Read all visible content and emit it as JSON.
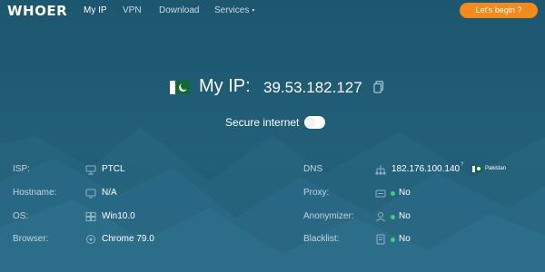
{
  "nav": {
    "logo": "WHOER",
    "items": [
      {
        "label": "My IP",
        "active": true
      },
      {
        "label": "VPN",
        "active": false
      },
      {
        "label": "Download",
        "active": false
      },
      {
        "label": "Services",
        "active": false
      }
    ],
    "services_caret": "▾",
    "cta_label": "Let's begin ?"
  },
  "hero": {
    "my_ip_label": "My IP:",
    "ip_address": "39.53.182.127",
    "flag_icon": "pakistan-flag-icon",
    "copy_icon": "copy-icon",
    "secure_label": "Secure internet",
    "secure_enabled": false
  },
  "left_rows": [
    {
      "label": "ISP:",
      "icon": "network-icon",
      "value": "PTCL"
    },
    {
      "label": "Hostname:",
      "icon": "monitor-icon",
      "value": "N/A"
    },
    {
      "label": "OS:",
      "icon": "windows-icon",
      "value": "Win10.0"
    },
    {
      "label": "Browser:",
      "icon": "browser-icon",
      "value": "Chrome 79.0"
    }
  ],
  "right_rows": [
    {
      "label": "DNS",
      "icon": "dns-icon",
      "value": "182.176.100.140",
      "sup": "?",
      "country": "Pakistan"
    },
    {
      "label": "Proxy:",
      "icon": "proxy-icon",
      "value": "No",
      "status": "green"
    },
    {
      "label": "Anonymizer:",
      "icon": "anonymizer-icon",
      "value": "No",
      "status": "green"
    },
    {
      "label": "Blacklist:",
      "icon": "blacklist-icon",
      "value": "No",
      "status": "green"
    }
  ],
  "colors": {
    "background": "#1f5a74",
    "accent": "#f28a1e",
    "status_ok": "#3ecf6e",
    "flag_green": "#0e6b32"
  }
}
